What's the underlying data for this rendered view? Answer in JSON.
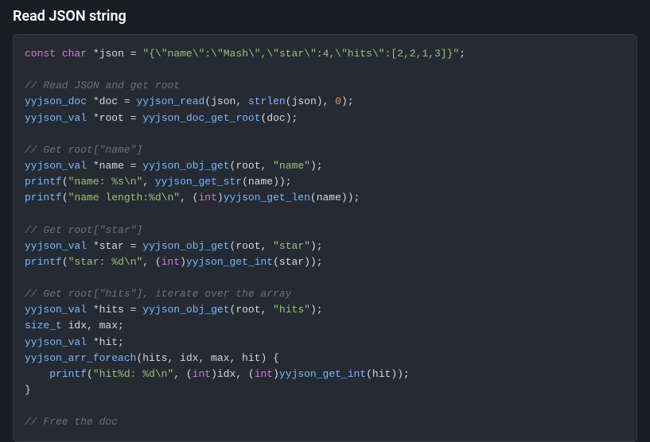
{
  "heading": "Read JSON string",
  "code": {
    "l01": {
      "kw": "const",
      "type": "char",
      "star": "*",
      "id": "json",
      "eq": "=",
      "str": "\"{\\\"name\\\":\\\"Mash\\\",\\\"star\\\":4,\\\"hits\\\":[2,2,1,3]}\"",
      "semi": ";"
    },
    "l03": {
      "cmt": "// Read JSON and get root"
    },
    "l04": {
      "type": "yyjson_doc",
      "star": "*",
      "id": "doc",
      "eq": "=",
      "fn": "yyjson_read",
      "args_a": "(json, ",
      "fn2": "strlen",
      "args_b": "(json), ",
      "num": "0",
      "close": ");"
    },
    "l05": {
      "type": "yyjson_val",
      "star": "*",
      "id": "root",
      "eq": "=",
      "fn": "yyjson_doc_get_root",
      "args": "(doc);"
    },
    "l07": {
      "cmt": "// Get root[\"name\"]"
    },
    "l08": {
      "type": "yyjson_val",
      "star": "*",
      "id": "name",
      "eq": "=",
      "fn": "yyjson_obj_get",
      "a": "(root, ",
      "str": "\"name\"",
      "b": ");"
    },
    "l09": {
      "fn": "printf",
      "a": "(",
      "str": "\"name: %s\\n\"",
      "b": ", ",
      "fn2": "yyjson_get_str",
      "c": "(name));"
    },
    "l10": {
      "fn": "printf",
      "a": "(",
      "str": "\"name length:%d\\n\"",
      "b": ", (",
      "cast": "int",
      "c": ")",
      "fn2": "yyjson_get_len",
      "d": "(name));"
    },
    "l12": {
      "cmt": "// Get root[\"star\"]"
    },
    "l13": {
      "type": "yyjson_val",
      "star": "*",
      "id": "star",
      "eq": "=",
      "fn": "yyjson_obj_get",
      "a": "(root, ",
      "str": "\"star\"",
      "b": ");"
    },
    "l14": {
      "fn": "printf",
      "a": "(",
      "str": "\"star: %d\\n\"",
      "b": ", (",
      "cast": "int",
      "c": ")",
      "fn2": "yyjson_get_int",
      "d": "(star));"
    },
    "l16": {
      "cmt": "// Get root[\"hits\"], iterate over the array"
    },
    "l17": {
      "type": "yyjson_val",
      "star": "*",
      "id": "hits",
      "eq": "=",
      "fn": "yyjson_obj_get",
      "a": "(root, ",
      "str": "\"hits\"",
      "b": ");"
    },
    "l18": {
      "type": "size_t",
      "ids": " idx, max;"
    },
    "l19": {
      "type": "yyjson_val",
      "star": "*",
      "id": "hit;"
    },
    "l20": {
      "fn": "yyjson_arr_foreach",
      "args": "(hits, idx, max, hit) {"
    },
    "l21": {
      "indent": "    ",
      "fn": "printf",
      "a": "(",
      "str": "\"hit%d: %d\\n\"",
      "b": ", (",
      "cast": "int",
      "c": ")idx, (",
      "cast2": "int",
      "d": ")",
      "fn2": "yyjson_get_int",
      "e": "(hit));"
    },
    "l22": {
      "brace": "}"
    },
    "l24": {
      "cmt": "// Free the doc"
    }
  }
}
